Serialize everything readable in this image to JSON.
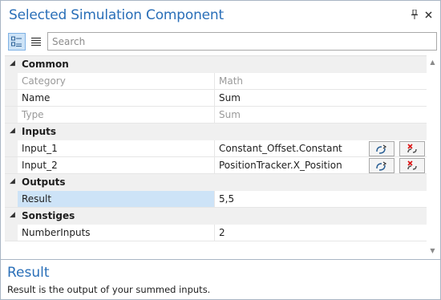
{
  "window": {
    "title": "Selected Simulation Component"
  },
  "title_buttons": {
    "pin_icon": "pin-icon",
    "close_icon": "close-icon"
  },
  "toolbar": {
    "categorized_icon": "categorized-view-icon",
    "alphabetical_icon": "alphabetical-view-icon",
    "search_placeholder": "Search",
    "search_value": ""
  },
  "grid": {
    "categories": [
      {
        "label": "Common",
        "properties": [
          {
            "name": "Category",
            "value": "Math"
          },
          {
            "name": "Name",
            "value": "Sum"
          },
          {
            "name": "Type",
            "value": "Sum"
          }
        ]
      },
      {
        "label": "Inputs",
        "properties": [
          {
            "name": "Input_1",
            "value": "Constant_Offset.Constant"
          },
          {
            "name": "Input_2",
            "value": "PositionTracker.X_Position"
          }
        ]
      },
      {
        "label": "Outputs",
        "properties": [
          {
            "name": "Result",
            "value": "5,5"
          }
        ]
      },
      {
        "label": "Sonstiges",
        "properties": [
          {
            "name": "NumberInputs",
            "value": "2"
          }
        ]
      }
    ]
  },
  "description": {
    "title": "Result",
    "text": "Result is the output of your summed inputs."
  },
  "colors": {
    "accent": "#2a6fb8",
    "selection": "#cde3f7",
    "category_bg": "#f0f0f0"
  }
}
